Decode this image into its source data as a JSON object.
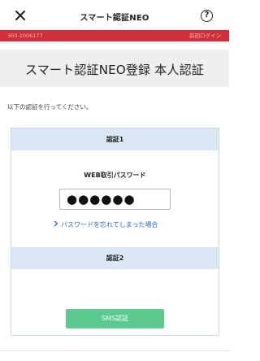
{
  "header": {
    "title": "スマート認証NEO",
    "close_icon": "close-icon",
    "help_icon": "help-icon",
    "help_glyph": "?"
  },
  "account_bar": {
    "account_number": "303-1006177",
    "login_text": "前回ログイン",
    "background_color": "#cf2f39"
  },
  "page": {
    "title": "スマート認証NEO登録 本人認証",
    "instruction": "以下の認証を行ってください。"
  },
  "auth1": {
    "heading": "認証1",
    "password_label": "WEB取引パスワード",
    "password_value": "●●●●●●",
    "forgot_link": "パスワードを忘れてしまった場合",
    "forgot_icon": "chevron-right-icon"
  },
  "auth2": {
    "heading": "認証2",
    "sms_button": "SMS認証",
    "sms_button_color": "#5cc98e"
  },
  "colors": {
    "card_header": "#dbe7f5",
    "link": "#2a6bc4"
  }
}
